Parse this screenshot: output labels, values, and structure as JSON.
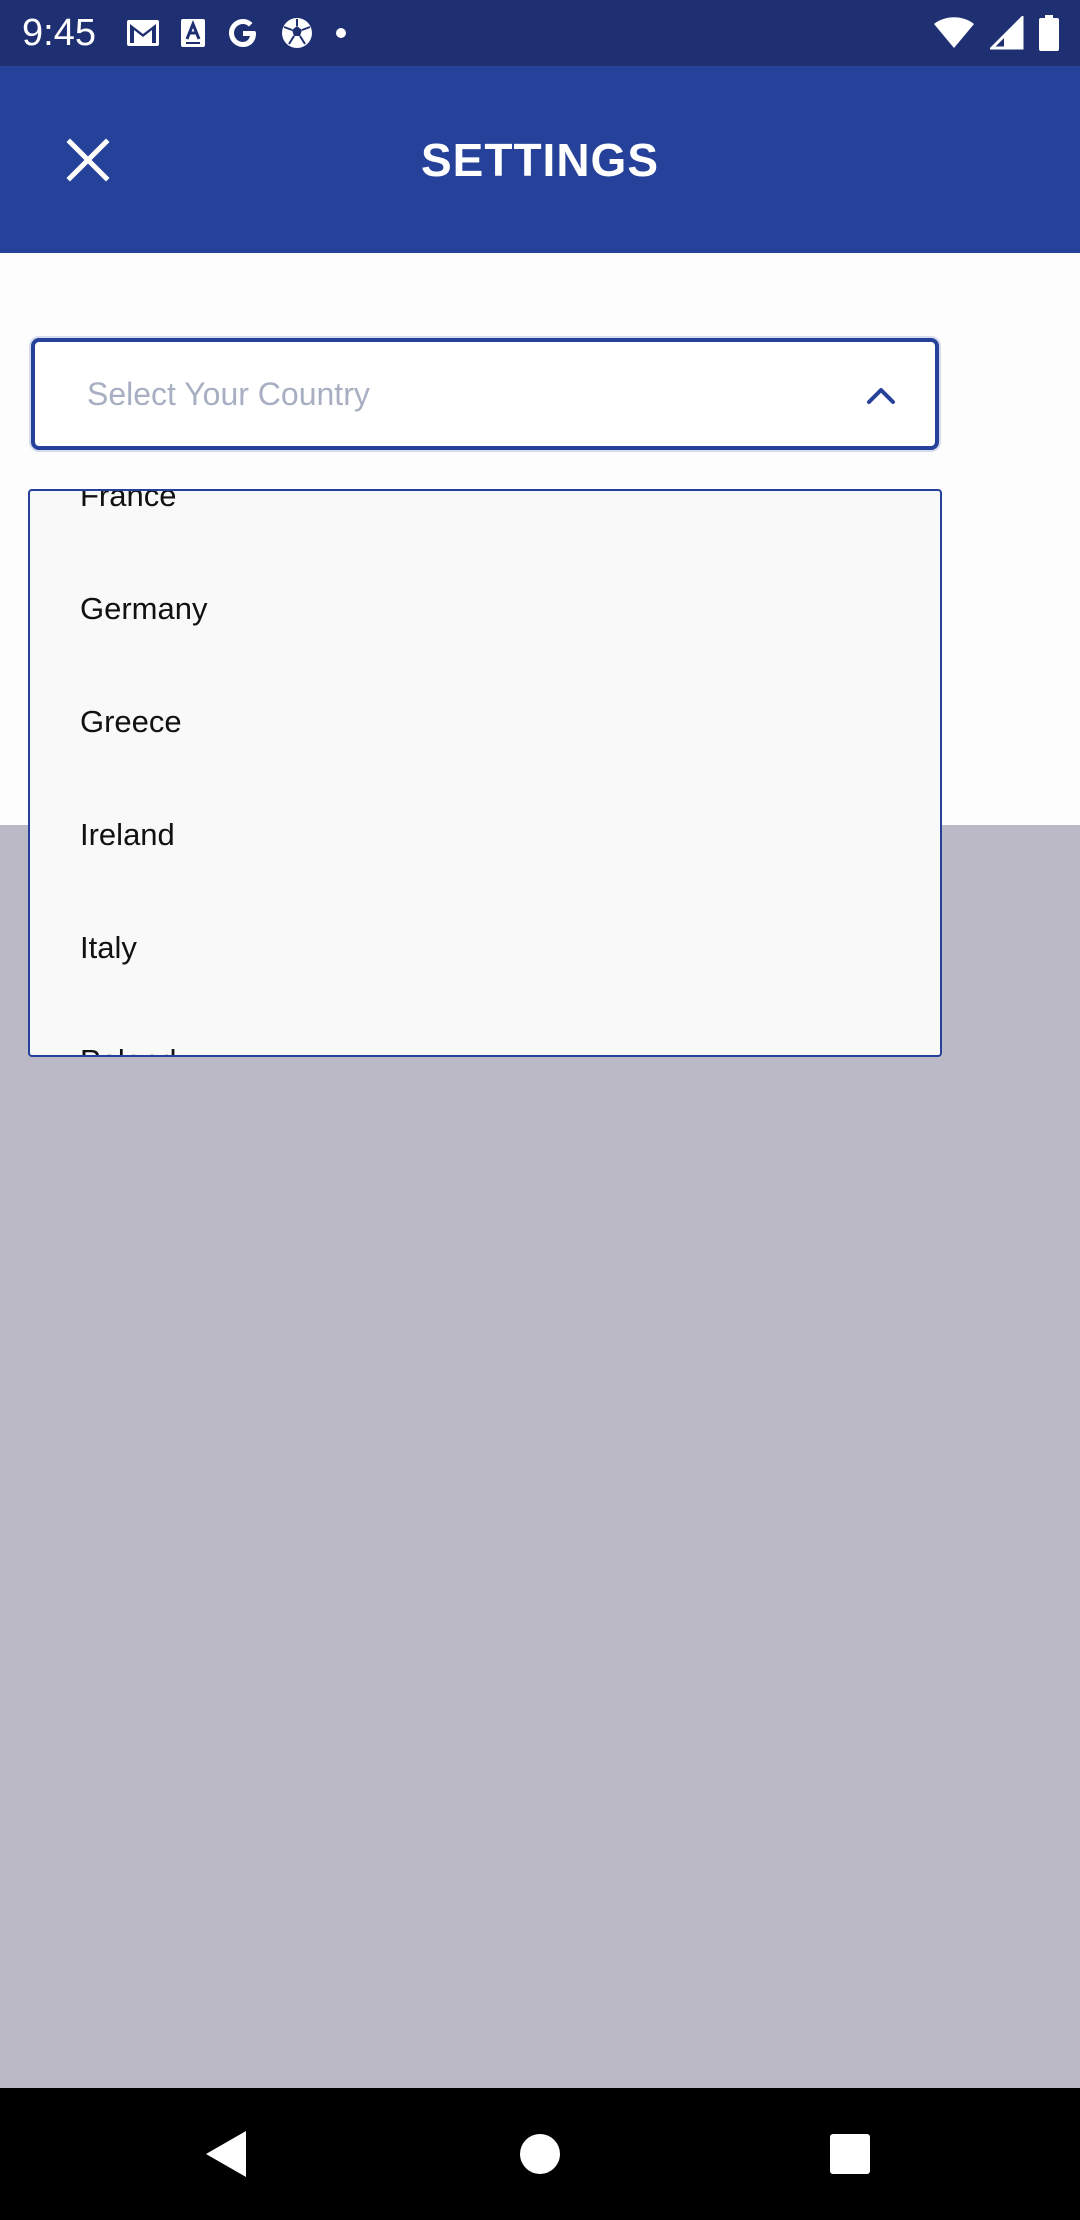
{
  "status_bar": {
    "time": "9:45",
    "left_icons": [
      "gmail-icon",
      "font-a-icon",
      "google-g-icon",
      "soccer-ball-icon",
      "dot-icon"
    ],
    "right_icons": [
      "wifi-icon",
      "cell-signal-icon",
      "battery-icon"
    ]
  },
  "app_bar": {
    "title": "SETTINGS",
    "close_icon": "close-icon"
  },
  "country_select": {
    "placeholder": "Select Your Country",
    "chevron_icon": "chevron-up-icon",
    "options": [
      "France",
      "Germany",
      "Greece",
      "Ireland",
      "Italy",
      "Poland"
    ]
  },
  "nav_bar": {
    "icons": [
      "back-icon",
      "home-icon",
      "recents-icon"
    ]
  },
  "colors": {
    "status_bar": "#1e2f72",
    "app_bar": "#26419a",
    "accent": "#26419a",
    "scrim": "#bab9c5",
    "dropdown_bg": "#f9f9f9"
  }
}
